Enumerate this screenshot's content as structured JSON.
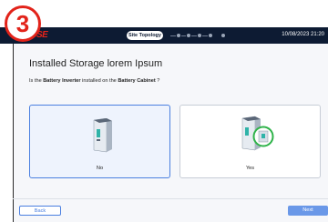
{
  "annotation": {
    "step_number": "3"
  },
  "header": {
    "logo_text": "SE",
    "step_label": "Site Topology",
    "datetime": "10/08/2023 21:20"
  },
  "main": {
    "title": "Installed Storage lorem Ipsum",
    "question_prefix": "Is the ",
    "question_bold1": "Battery Inverter",
    "question_mid": " installed on the ",
    "question_bold2": "Battery Cabinet",
    "question_suffix": " ?",
    "options": [
      {
        "label": "No",
        "selected": true
      },
      {
        "label": "Yes",
        "selected": false
      }
    ]
  },
  "footer": {
    "back_label": "Back",
    "next_label": "Next"
  },
  "colors": {
    "header_bg": "#0d1b33",
    "accent": "#4a7fe0",
    "brand": "#e2231a",
    "check": "#2fb34a"
  }
}
